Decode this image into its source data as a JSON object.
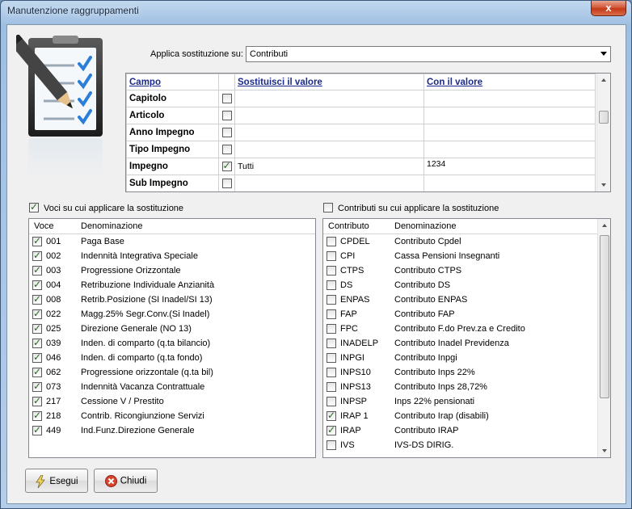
{
  "window": {
    "title": "Manutenzione raggruppamenti",
    "close_label": "x"
  },
  "apply": {
    "label": "Applica sostituzione su:",
    "selected": "Contributi"
  },
  "grid": {
    "headers": [
      "Campo",
      "Sostituisci il valore",
      "Con il valore"
    ],
    "rows": [
      {
        "field": "Capitolo",
        "checked": false,
        "replace": "",
        "with": ""
      },
      {
        "field": "Articolo",
        "checked": false,
        "replace": "",
        "with": ""
      },
      {
        "field": "Anno Impegno",
        "checked": false,
        "replace": "",
        "with": ""
      },
      {
        "field": "Tipo Impegno",
        "checked": false,
        "replace": "",
        "with": ""
      },
      {
        "field": "Impegno",
        "checked": true,
        "replace": "Tutti",
        "with": "1234"
      },
      {
        "field": "Sub Impegno",
        "checked": false,
        "replace": "",
        "with": ""
      }
    ]
  },
  "voci": {
    "section_label": "Voci su cui applicare la sostituzione",
    "section_checked": true,
    "col_code": "Voce",
    "col_desc": "Denominazione",
    "items": [
      {
        "code": "001",
        "desc": "Paga Base",
        "checked": true
      },
      {
        "code": "002",
        "desc": "Indennità Integrativa Speciale",
        "checked": true
      },
      {
        "code": "003",
        "desc": "Progressione Orizzontale",
        "checked": true
      },
      {
        "code": "004",
        "desc": "Retribuzione Individuale Anzianità",
        "checked": true
      },
      {
        "code": "008",
        "desc": "Retrib.Posizione (SI Inadel/SI 13)",
        "checked": true
      },
      {
        "code": "022",
        "desc": "Magg.25% Segr.Conv.(Si Inadel)",
        "checked": true
      },
      {
        "code": "025",
        "desc": "Direzione Generale (NO 13)",
        "checked": true
      },
      {
        "code": "039",
        "desc": "Inden. di comparto (q.ta bilancio)",
        "checked": true
      },
      {
        "code": "046",
        "desc": "Inden. di comparto (q.ta fondo)",
        "checked": true
      },
      {
        "code": "062",
        "desc": "Progressione orizzontale (q.ta bil)",
        "checked": true
      },
      {
        "code": "073",
        "desc": "Indennità Vacanza Contrattuale",
        "checked": true
      },
      {
        "code": "217",
        "desc": "Cessione V / Prestito",
        "checked": true
      },
      {
        "code": "218",
        "desc": "Contrib. Ricongiunzione Servizi",
        "checked": true
      },
      {
        "code": "449",
        "desc": "Ind.Funz.Direzione Generale",
        "checked": true
      }
    ]
  },
  "contributi": {
    "section_label": "Contributi su cui applicare la sostituzione",
    "section_checked": false,
    "col_code": "Contributo",
    "col_desc": "Denominazione",
    "items": [
      {
        "code": "CPDEL",
        "desc": "Contributo Cpdel",
        "checked": false
      },
      {
        "code": "CPI",
        "desc": "Cassa Pensioni Insegnanti",
        "checked": false
      },
      {
        "code": "CTPS",
        "desc": "Contributo CTPS",
        "checked": false
      },
      {
        "code": "DS",
        "desc": "Contributo DS",
        "checked": false
      },
      {
        "code": "ENPAS",
        "desc": "Contributo ENPAS",
        "checked": false
      },
      {
        "code": "FAP",
        "desc": "Contributo FAP",
        "checked": false
      },
      {
        "code": "FPC",
        "desc": "Contributo F.do Prev.za e Credito",
        "checked": false
      },
      {
        "code": "INADELP",
        "desc": "Contributo Inadel Previdenza",
        "checked": false
      },
      {
        "code": "INPGI",
        "desc": "Contributo Inpgi",
        "checked": false
      },
      {
        "code": "INPS10",
        "desc": "Contributo Inps 22%",
        "checked": false
      },
      {
        "code": "INPS13",
        "desc": "Contributo Inps 28,72%",
        "checked": false
      },
      {
        "code": "INPSP",
        "desc": "Inps 22% pensionati",
        "checked": false
      },
      {
        "code": "IRAP 1",
        "desc": "Contributo Irap (disabili)",
        "checked": true
      },
      {
        "code": "IRAP",
        "desc": "Contributo IRAP",
        "checked": true
      },
      {
        "code": "IVS",
        "desc": "IVS-DS DIRIG.",
        "checked": false
      }
    ]
  },
  "buttons": {
    "run": "Esegui",
    "close": "Chiudi"
  },
  "icons": {
    "logo": "clipboard-checklist-pencil-icon",
    "run": "lightning-icon",
    "close": "close-circle-icon"
  }
}
